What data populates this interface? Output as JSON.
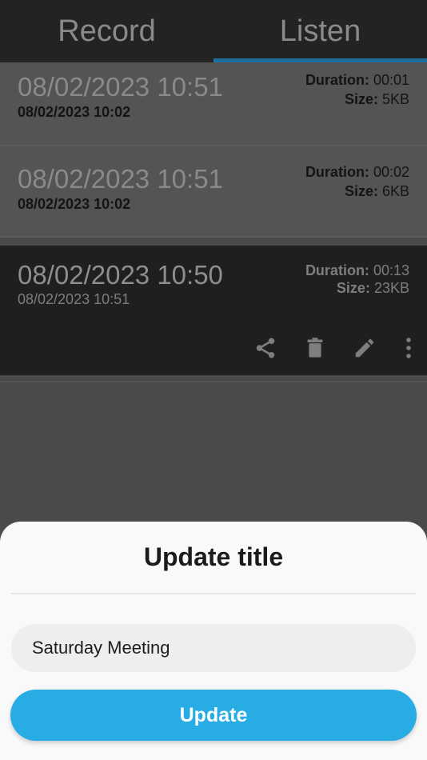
{
  "tabs": [
    {
      "label": "Record",
      "active": false
    },
    {
      "label": "Listen",
      "active": true
    }
  ],
  "recordings": [
    {
      "title": "08/02/2023 10:51",
      "subtitle": "08/02/2023 10:02",
      "duration_label": "Duration:",
      "duration": "00:01",
      "size_label": "Size:",
      "size": "5KB"
    },
    {
      "title": "08/02/2023 10:51",
      "subtitle": "08/02/2023 10:02",
      "duration_label": "Duration:",
      "duration": "00:02",
      "size_label": "Size:",
      "size": "6KB"
    },
    {
      "title": "08/02/2023 10:50",
      "subtitle": "08/02/2023 10:51",
      "duration_label": "Duration:",
      "duration": "00:13",
      "size_label": "Size:",
      "size": "23KB",
      "selected": true
    }
  ],
  "actions": {
    "share_icon": "share-icon",
    "delete_icon": "trash-icon",
    "edit_icon": "pencil-icon",
    "more_icon": "more-vertical-icon"
  },
  "sheet": {
    "title": "Update title",
    "input_value": "Saturday Meeting",
    "button_label": "Update"
  },
  "colors": {
    "accent": "#27ace3",
    "tab_indicator": "#1d6f9e",
    "tabbar_bg": "#232323"
  }
}
